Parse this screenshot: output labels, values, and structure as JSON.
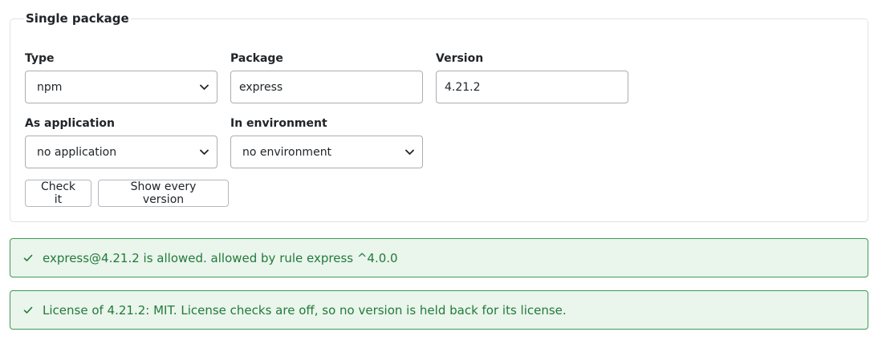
{
  "form": {
    "legend": "Single package",
    "type": {
      "label": "Type",
      "value": "npm"
    },
    "package": {
      "label": "Package",
      "value": "express"
    },
    "version": {
      "label": "Version",
      "value": "4.21.2"
    },
    "application": {
      "label": "As application",
      "value": "no application"
    },
    "environment": {
      "label": "In environment",
      "value": "no environment"
    },
    "buttons": {
      "check": "Check it",
      "show_all": "Show every version"
    }
  },
  "alerts": [
    {
      "icon": "check-icon",
      "text": "express@4.21.2 is allowed. allowed by rule express ^4.0.0"
    },
    {
      "icon": "check-icon",
      "text": "License of 4.21.2: MIT. License checks are off, so no version is held back for its license."
    }
  ],
  "colors": {
    "success_text": "#237a3a",
    "success_bg": "#eaf5ec",
    "success_border": "#3e9a55"
  }
}
